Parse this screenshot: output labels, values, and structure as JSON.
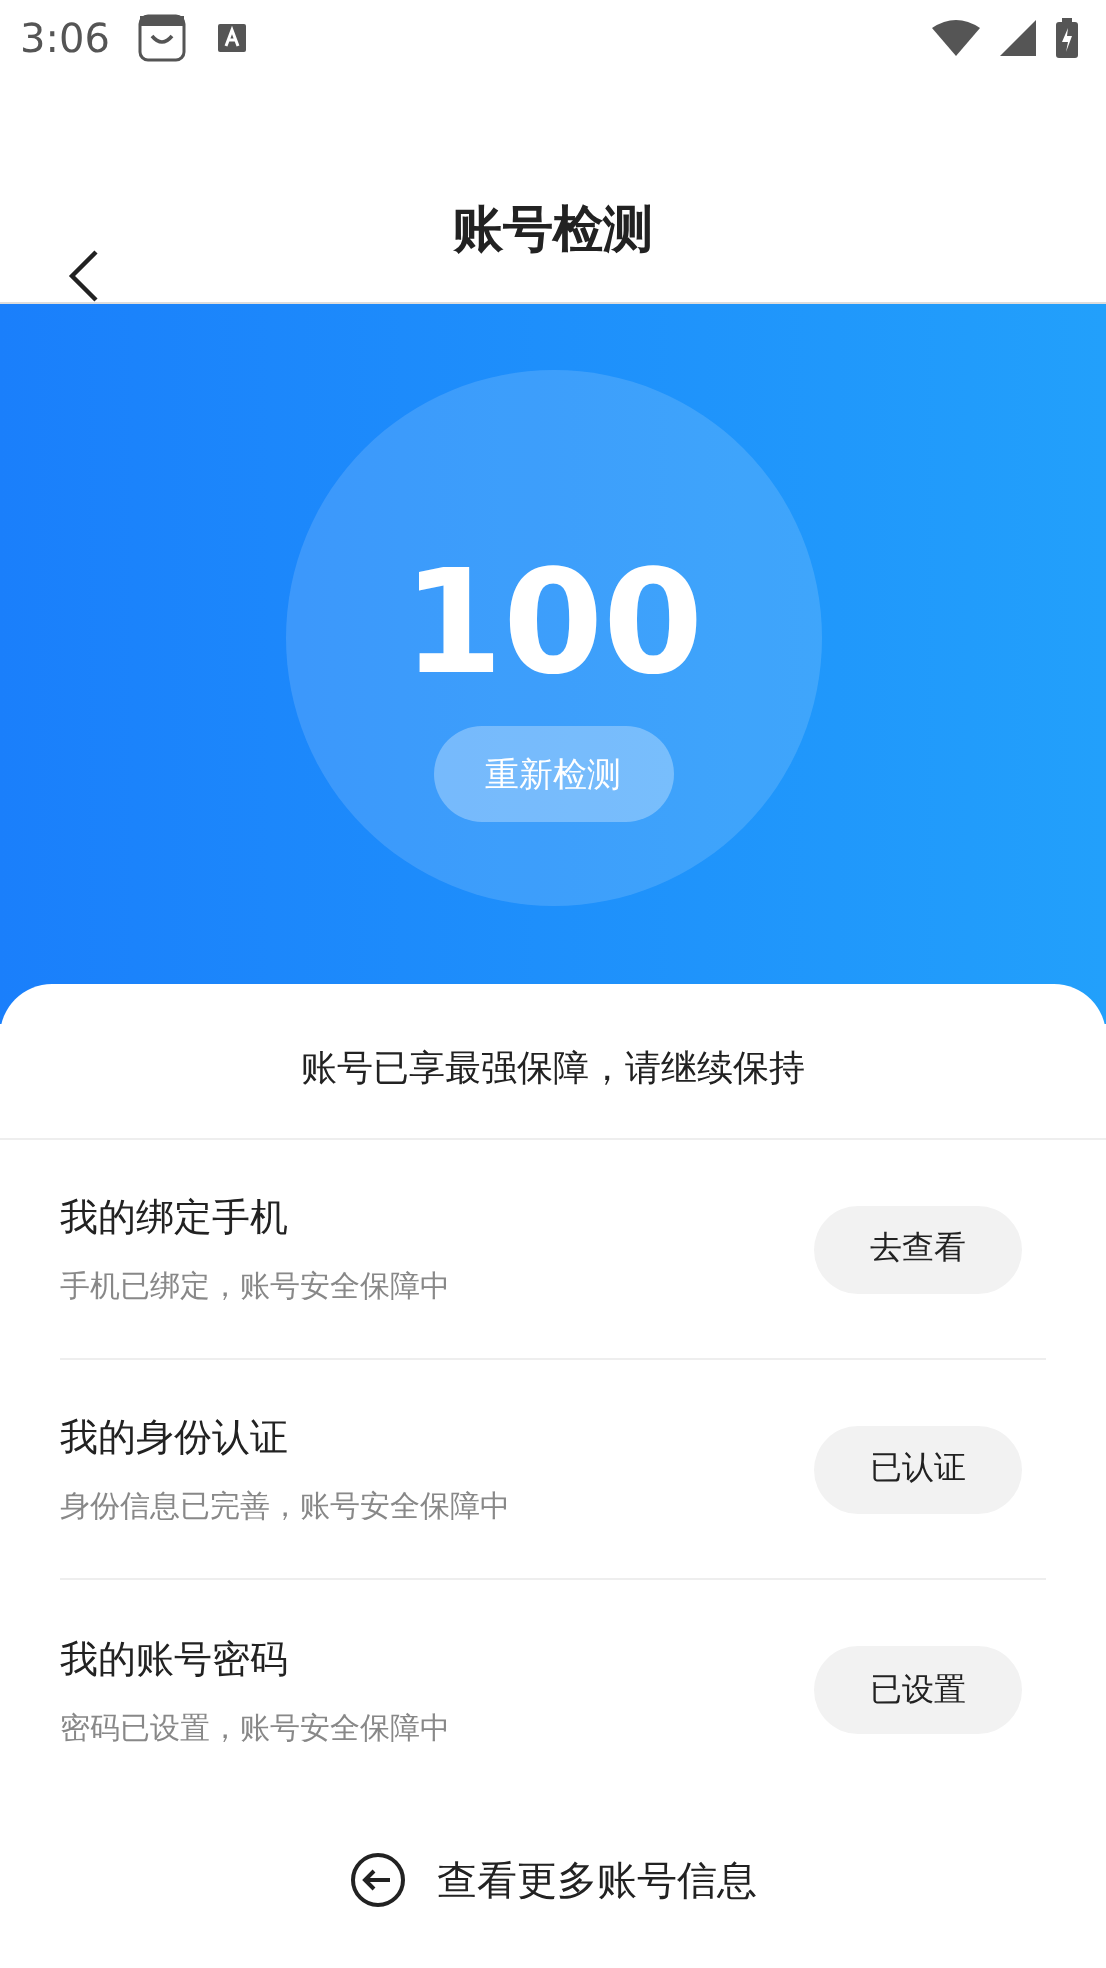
{
  "status_bar": {
    "time": "3:06"
  },
  "header": {
    "title": "账号检测"
  },
  "score": {
    "value": "100",
    "button": "重新检测"
  },
  "summary": "账号已享最强保障，请继续保持",
  "items": [
    {
      "title": "我的绑定手机",
      "subtitle": "手机已绑定，账号安全保障中",
      "action": "去查看"
    },
    {
      "title": "我的身份认证",
      "subtitle": "身份信息已完善，账号安全保障中",
      "action": "已认证"
    },
    {
      "title": "我的账号密码",
      "subtitle": "密码已设置，账号安全保障中",
      "action": "已设置"
    }
  ],
  "footer_link": "查看更多账号信息"
}
